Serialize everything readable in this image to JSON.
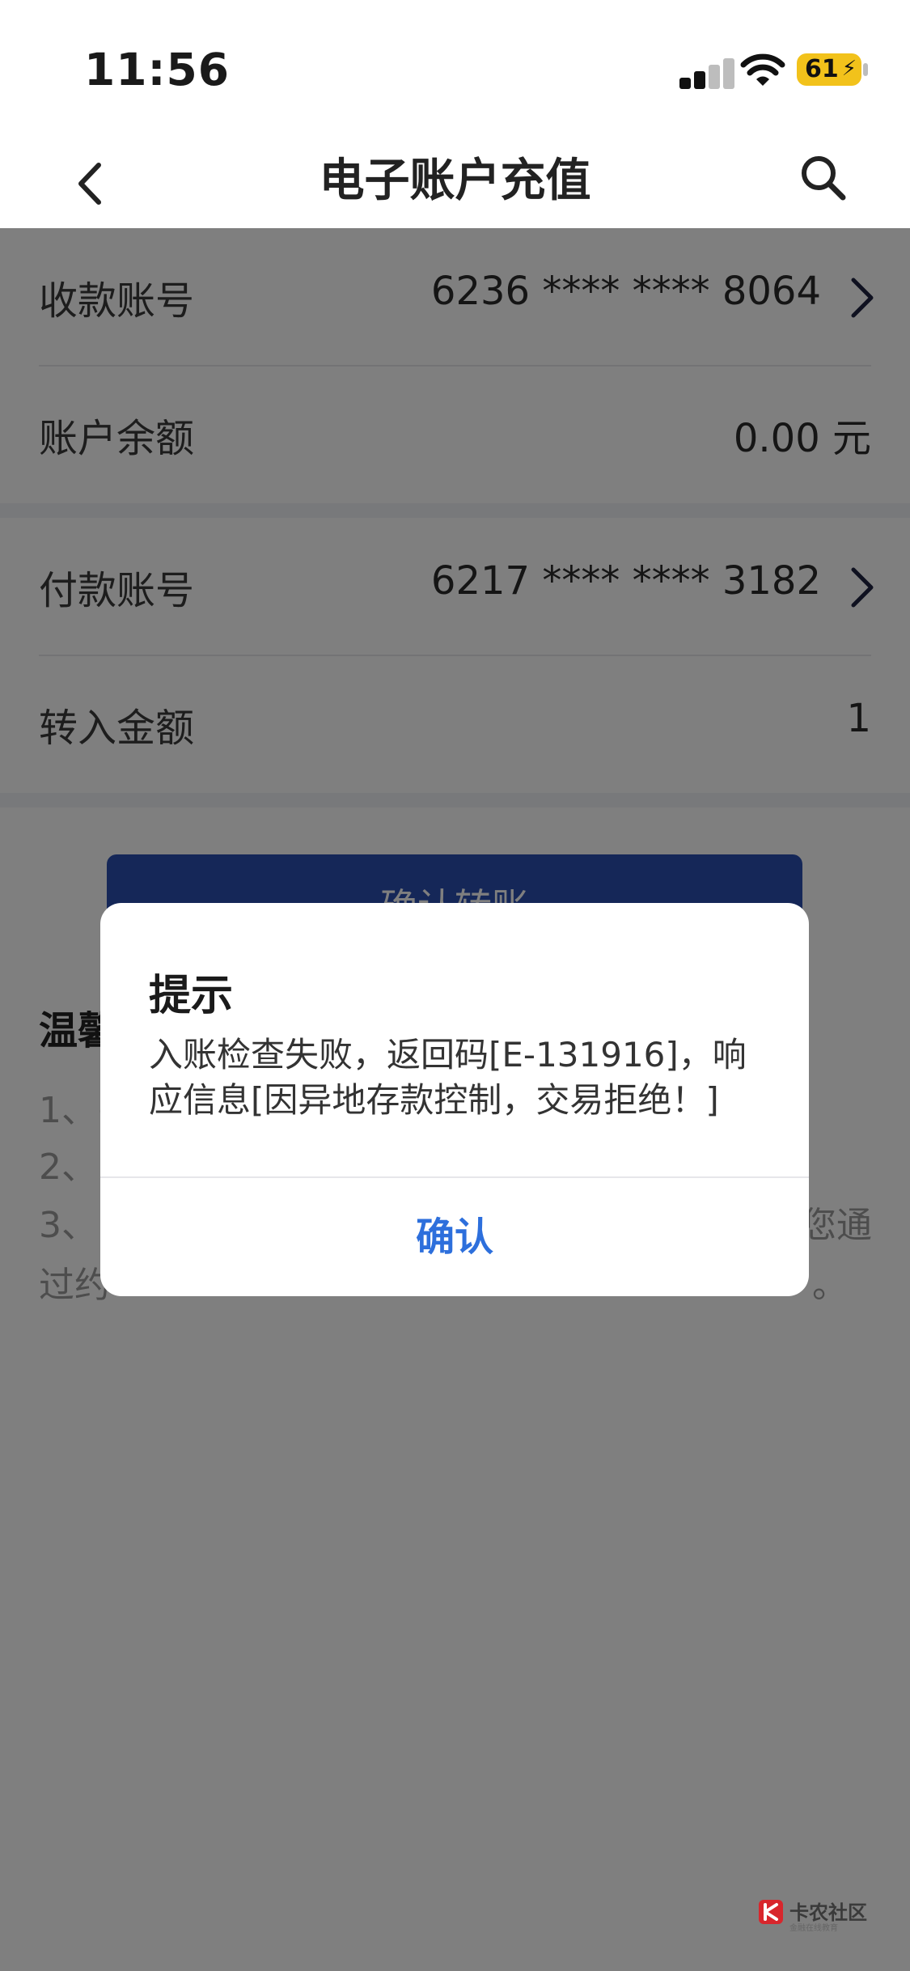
{
  "status_bar": {
    "time": "11:56",
    "battery": "61"
  },
  "nav": {
    "title": "电子账户充值"
  },
  "form": {
    "payee_label": "收款账号",
    "payee_value": "6236 **** **** 8064",
    "balance_label": "账户余额",
    "balance_value": "0.00 元",
    "payer_label": "付款账号",
    "payer_value": "6217 **** **** 3182",
    "amount_label": "转入金额",
    "amount_value": "1"
  },
  "confirm_button": "确认转账",
  "tips": {
    "title_partial": "温馨",
    "item1": "1、(",
    "item2": "2、",
    "item3": "3、",
    "item3_right": "您通",
    "item3_line2_left": "过约",
    "item3_line2_right": "。"
  },
  "dialog": {
    "title": "提示",
    "message": "入账检查失败，返回码[E-131916]，响应信息[因异地存款控制，交易拒绝！]",
    "confirm": "确认"
  },
  "watermark": {
    "brand": "卡农社区",
    "sub": "金融在线教育"
  },
  "colors": {
    "primary": "#2a4fb0",
    "dialog_button": "#2d6fdc",
    "battery": "#f2c21b"
  }
}
